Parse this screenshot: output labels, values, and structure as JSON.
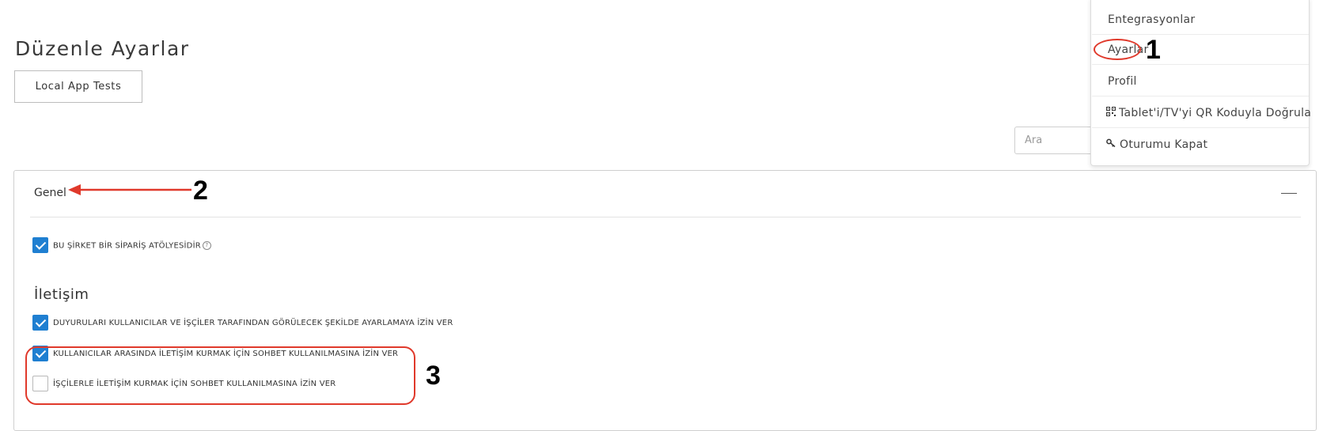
{
  "page": {
    "title": "Düzenle Ayarlar",
    "app_button_label": "Local App Tests",
    "search": {
      "placeholder": "Ara",
      "value": ""
    }
  },
  "panel": {
    "title": "Genel",
    "collapse_icon": "minus-icon",
    "options": [
      {
        "label": "BU ŞİRKET BİR SİPARİŞ ATÖLYESİDİR",
        "checked": true,
        "has_help_icon": true
      }
    ],
    "communication_heading": "İletişim",
    "communication_options": [
      {
        "label": "DUYURULARI KULLANICILAR VE İŞÇİLER TARAFINDAN GÖRÜLECEK ŞEKİLDE AYARLAMAYA İZİN VER",
        "checked": true
      },
      {
        "label": "KULLANICILAR ARASINDA İLETİŞİM KURMAK İÇİN SOHBET KULLANILMASINA İZİN VER",
        "checked": true
      },
      {
        "label": "İŞÇİLERLE İLETİŞİM KURMAK İÇİN SOHBET KULLANILMASINA İZİN VER",
        "checked": false
      }
    ]
  },
  "dropdown": {
    "items": [
      {
        "label": "Entegrasyonlar",
        "icon": ""
      },
      {
        "label": "Ayarlar",
        "icon": ""
      },
      {
        "label": "Profil",
        "icon": ""
      },
      {
        "label": "Tablet'i/TV'yi QR Koduyla Doğrula",
        "icon": "qr-code-icon"
      },
      {
        "label": "Oturumu Kapat",
        "icon": "key-icon"
      }
    ]
  },
  "annotations": {
    "marker_1": "1",
    "marker_2": "2",
    "marker_3": "3",
    "color": "#e0392b"
  },
  "colors": {
    "checkbox_checked": "#1f7fd1",
    "border": "#cfcfcf"
  }
}
